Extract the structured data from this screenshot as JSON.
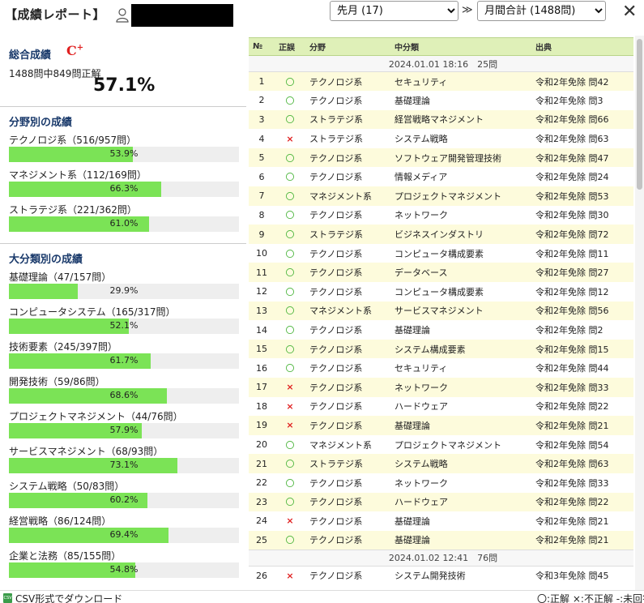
{
  "header": {
    "title": "【成績レポート】",
    "month_select": "先月 (17)",
    "range_select": "月間合計 (1488問)",
    "nav_icon": "double-chevron-right-icon",
    "close_icon": "close-icon"
  },
  "overall": {
    "title": "総合成績",
    "grade": "C",
    "grade_suffix": "+",
    "summary": "1488問中849問正解",
    "percent": "57.1%",
    "grade_color": "#e02020"
  },
  "field": {
    "title": "分野別の成績",
    "items": [
      {
        "label": "テクノロジ系（516/957問）",
        "pct_text": "53.9%",
        "pct": 53.9
      },
      {
        "label": "マネジメント系（112/169問）",
        "pct_text": "66.3%",
        "pct": 66.3
      },
      {
        "label": "ストラテジ系（221/362問）",
        "pct_text": "61.0%",
        "pct": 61.0
      }
    ]
  },
  "major": {
    "title": "大分類別の成績",
    "items": [
      {
        "label": "基礎理論（47/157問）",
        "pct_text": "29.9%",
        "pct": 29.9
      },
      {
        "label": "コンピュータシステム（165/317問）",
        "pct_text": "52.1%",
        "pct": 52.1
      },
      {
        "label": "技術要素（245/397問）",
        "pct_text": "61.7%",
        "pct": 61.7
      },
      {
        "label": "開発技術（59/86問）",
        "pct_text": "68.6%",
        "pct": 68.6
      },
      {
        "label": "プロジェクトマネジメント（44/76問）",
        "pct_text": "57.9%",
        "pct": 57.9
      },
      {
        "label": "サービスマネジメント（68/93問）",
        "pct_text": "73.1%",
        "pct": 73.1
      },
      {
        "label": "システム戦略（50/83問）",
        "pct_text": "60.2%",
        "pct": 60.2
      },
      {
        "label": "経営戦略（86/124問）",
        "pct_text": "69.4%",
        "pct": 69.4
      },
      {
        "label": "企業と法務（85/155問）",
        "pct_text": "54.8%",
        "pct": 54.8
      }
    ]
  },
  "bar_color": "#7be356",
  "table": {
    "columns": [
      "№",
      "正誤",
      "分野",
      "中分類",
      "出典"
    ],
    "groups": [
      {
        "header": "2024.01.01 18:16　25問",
        "rows": [
          {
            "no": "1",
            "mark": "〇",
            "field": "テクノロジ系",
            "cat": "セキュリティ",
            "src": "令和2年免除 問42"
          },
          {
            "no": "2",
            "mark": "〇",
            "field": "テクノロジ系",
            "cat": "基礎理論",
            "src": "令和2年免除 問3"
          },
          {
            "no": "3",
            "mark": "〇",
            "field": "ストラテジ系",
            "cat": "経営戦略マネジメント",
            "src": "令和2年免除 問66"
          },
          {
            "no": "4",
            "mark": "×",
            "field": "ストラテジ系",
            "cat": "システム戦略",
            "src": "令和2年免除 問63"
          },
          {
            "no": "5",
            "mark": "〇",
            "field": "テクノロジ系",
            "cat": "ソフトウェア開発管理技術",
            "src": "令和2年免除 問47"
          },
          {
            "no": "6",
            "mark": "〇",
            "field": "テクノロジ系",
            "cat": "情報メディア",
            "src": "令和2年免除 問24"
          },
          {
            "no": "7",
            "mark": "〇",
            "field": "マネジメント系",
            "cat": "プロジェクトマネジメント",
            "src": "令和2年免除 問53"
          },
          {
            "no": "8",
            "mark": "〇",
            "field": "テクノロジ系",
            "cat": "ネットワーク",
            "src": "令和2年免除 問30"
          },
          {
            "no": "9",
            "mark": "〇",
            "field": "ストラテジ系",
            "cat": "ビジネスインダストリ",
            "src": "令和2年免除 問72"
          },
          {
            "no": "10",
            "mark": "〇",
            "field": "テクノロジ系",
            "cat": "コンピュータ構成要素",
            "src": "令和2年免除 問11"
          },
          {
            "no": "11",
            "mark": "〇",
            "field": "テクノロジ系",
            "cat": "データベース",
            "src": "令和2年免除 問27"
          },
          {
            "no": "12",
            "mark": "〇",
            "field": "テクノロジ系",
            "cat": "コンピュータ構成要素",
            "src": "令和2年免除 問12"
          },
          {
            "no": "13",
            "mark": "〇",
            "field": "マネジメント系",
            "cat": "サービスマネジメント",
            "src": "令和2年免除 問56"
          },
          {
            "no": "14",
            "mark": "〇",
            "field": "テクノロジ系",
            "cat": "基礎理論",
            "src": "令和2年免除 問2"
          },
          {
            "no": "15",
            "mark": "〇",
            "field": "テクノロジ系",
            "cat": "システム構成要素",
            "src": "令和2年免除 問15"
          },
          {
            "no": "16",
            "mark": "〇",
            "field": "テクノロジ系",
            "cat": "セキュリティ",
            "src": "令和2年免除 問44"
          },
          {
            "no": "17",
            "mark": "×",
            "field": "テクノロジ系",
            "cat": "ネットワーク",
            "src": "令和2年免除 問33"
          },
          {
            "no": "18",
            "mark": "×",
            "field": "テクノロジ系",
            "cat": "ハードウェア",
            "src": "令和2年免除 問22"
          },
          {
            "no": "19",
            "mark": "×",
            "field": "テクノロジ系",
            "cat": "基礎理論",
            "src": "令和2年免除 問21"
          },
          {
            "no": "20",
            "mark": "〇",
            "field": "マネジメント系",
            "cat": "プロジェクトマネジメント",
            "src": "令和2年免除 問54"
          },
          {
            "no": "21",
            "mark": "〇",
            "field": "ストラテジ系",
            "cat": "システム戦略",
            "src": "令和2年免除 問63"
          },
          {
            "no": "22",
            "mark": "〇",
            "field": "テクノロジ系",
            "cat": "ネットワーク",
            "src": "令和2年免除 問33"
          },
          {
            "no": "23",
            "mark": "〇",
            "field": "テクノロジ系",
            "cat": "ハードウェア",
            "src": "令和2年免除 問22"
          },
          {
            "no": "24",
            "mark": "×",
            "field": "テクノロジ系",
            "cat": "基礎理論",
            "src": "令和2年免除 問21"
          },
          {
            "no": "25",
            "mark": "〇",
            "field": "テクノロジ系",
            "cat": "基礎理論",
            "src": "令和2年免除 問21"
          }
        ]
      },
      {
        "header": "2024.01.02 12:41　76問",
        "rows": [
          {
            "no": "26",
            "mark": "×",
            "field": "テクノロジ系",
            "cat": "システム開発技術",
            "src": "令和3年免除 問45"
          }
        ]
      }
    ]
  },
  "footer": {
    "csv_icon_text": "CSV",
    "csv_label": "CSV形式でダウンロード",
    "legend": "〇:正解 ×:不正解 -:未回答"
  }
}
